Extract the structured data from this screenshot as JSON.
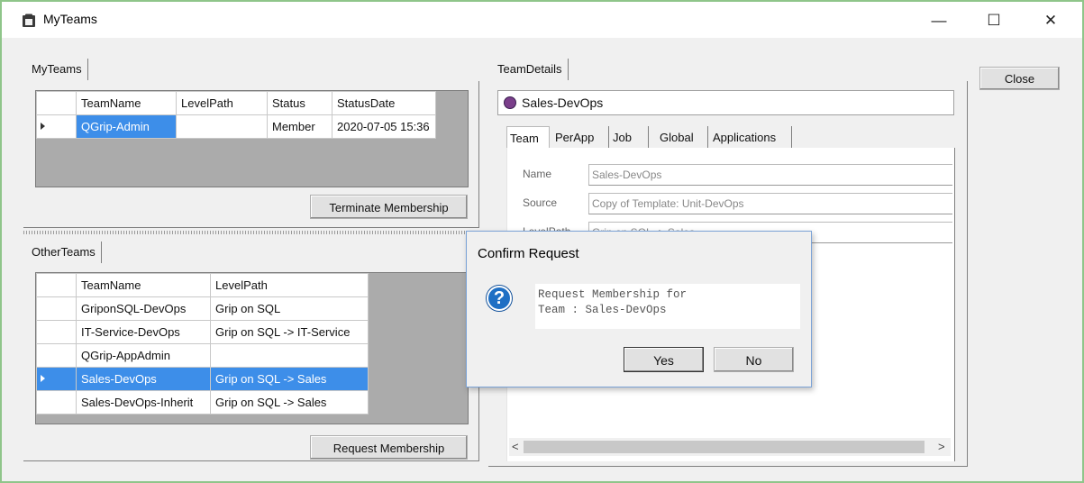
{
  "window": {
    "title": "MyTeams",
    "controls": {
      "minimize": "—",
      "maximize": "☐",
      "close": "✕"
    }
  },
  "my_teams": {
    "tab_label": "MyTeams",
    "columns": [
      "TeamName",
      "LevelPath",
      "Status",
      "StatusDate"
    ],
    "rows": [
      {
        "team_name": "QGrip-Admin",
        "level_path": "",
        "status": "Member",
        "status_date": "2020-07-05 15:36"
      }
    ],
    "terminate_label": "Terminate Membership"
  },
  "other_teams": {
    "tab_label": "OtherTeams",
    "columns": [
      "TeamName",
      "LevelPath"
    ],
    "rows": [
      {
        "team_name": "GriponSQL-DevOps",
        "level_path": "Grip on SQL"
      },
      {
        "team_name": "IT-Service-DevOps",
        "level_path": "Grip on SQL -> IT-Service"
      },
      {
        "team_name": "QGrip-AppAdmin",
        "level_path": ""
      },
      {
        "team_name": "Sales-DevOps",
        "level_path": "Grip on SQL -> Sales"
      },
      {
        "team_name": "Sales-DevOps-Inherit",
        "level_path": "Grip on SQL -> Sales"
      }
    ],
    "request_label": "Request Membership"
  },
  "team_details": {
    "tab_label": "TeamDetails",
    "team_title": "Sales-DevOps",
    "tabs": [
      "Team",
      "PerApp",
      "Job",
      "Global",
      "Applications"
    ],
    "fields": {
      "name_label": "Name",
      "name_value": "Sales-DevOps",
      "source_label": "Source",
      "source_value": "Copy of Template: Unit-DevOps",
      "levelpath_label": "LevelPath",
      "levelpath_value": "Grip on SQL -> Sales"
    },
    "scroll_left": "<",
    "scroll_right": ">"
  },
  "close_label": "Close",
  "dialog": {
    "title": "Confirm Request",
    "icon": "question-icon",
    "message_line1": "Request Membership for",
    "message_line2": "Team : Sales-DevOps",
    "yes_label": "Yes",
    "no_label": "No"
  },
  "colors": {
    "selection": "#3d8ee9",
    "window_border": "#8fc58a",
    "dialog_border": "#7aa2d6"
  }
}
